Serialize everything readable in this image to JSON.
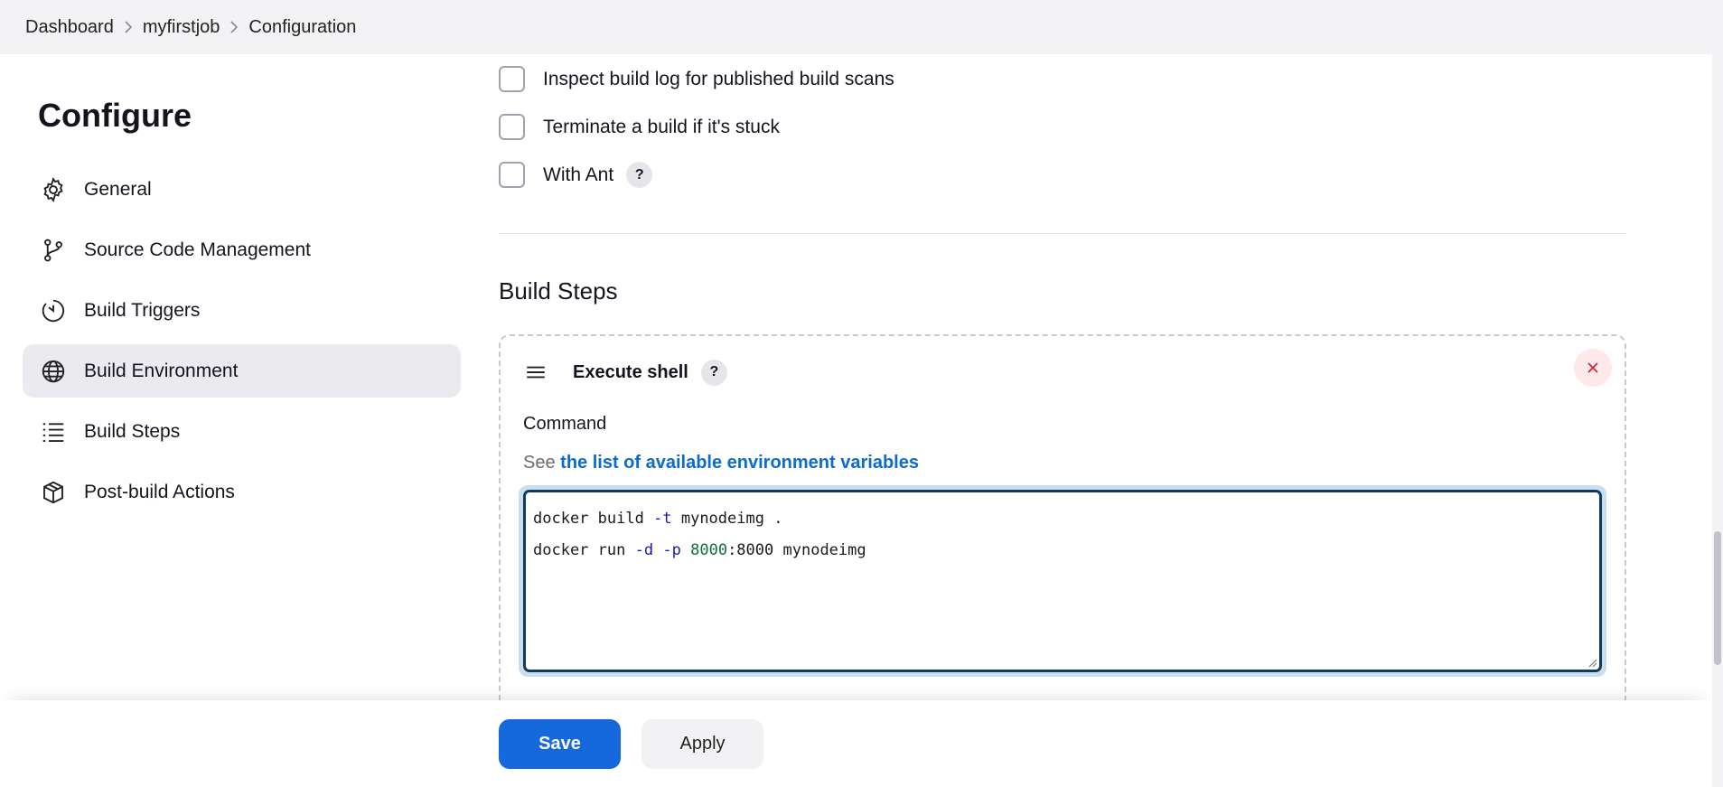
{
  "breadcrumb": [
    "Dashboard",
    "myfirstjob",
    "Configuration"
  ],
  "sidebar": {
    "title": "Configure",
    "items": [
      {
        "label": "General",
        "icon": "gear-icon"
      },
      {
        "label": "Source Code Management",
        "icon": "branch-icon"
      },
      {
        "label": "Build Triggers",
        "icon": "timer-icon"
      },
      {
        "label": "Build Environment",
        "icon": "globe-icon",
        "active": true
      },
      {
        "label": "Build Steps",
        "icon": "list-icon"
      },
      {
        "label": "Post-build Actions",
        "icon": "package-icon"
      }
    ]
  },
  "options": [
    {
      "label": "Inspect build log for published build scans",
      "checked": false
    },
    {
      "label": "Terminate a build if it's stuck",
      "checked": false
    },
    {
      "label": "With Ant",
      "checked": false,
      "help": "?"
    }
  ],
  "build_steps": {
    "title": "Build Steps",
    "step": {
      "title": "Execute shell",
      "help": "?",
      "command_label": "Command",
      "see_prefix": "See",
      "env_link": "the list of available environment variables",
      "command_lines": [
        "docker build -t mynodeimg .",
        "docker run -d -p 8000:8000 mynodeimg"
      ]
    }
  },
  "footer": {
    "save_label": "Save",
    "apply_label": "Apply"
  },
  "colors": {
    "primary": "#1669dd",
    "active_nav": "#ebebef",
    "close_bg": "#fde8ea",
    "close_icon": "#d7263d"
  }
}
